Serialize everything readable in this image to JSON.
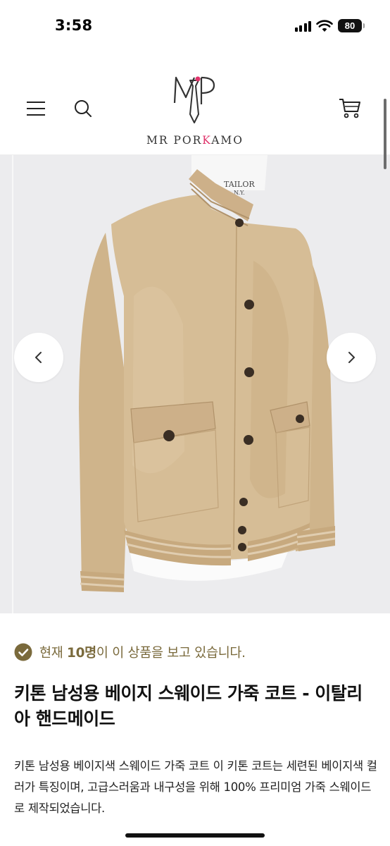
{
  "status_bar": {
    "time": "3:58",
    "battery": "80",
    "icons": [
      "cellular-signal-icon",
      "wifi-icon",
      "battery-icon"
    ]
  },
  "header": {
    "logo_mark": "MP",
    "logo_text_part1": "MR POR",
    "logo_text_accent": "K",
    "logo_text_part2": "AMO",
    "accent_color": "#e0336b",
    "icons": [
      "menu-icon",
      "search-icon",
      "cart-icon"
    ]
  },
  "gallery": {
    "mannequin_label": "TAILOR\nN.Y.",
    "prev_icon": "chevron-left-icon",
    "next_icon": "chevron-right-icon"
  },
  "product": {
    "viewers_prefix": "현재 ",
    "viewers_count": "10명",
    "viewers_suffix": "이 이 상품을 보고 있습니다.",
    "viewers_color": "#7a6a3c",
    "title": "키톤 남성용 베이지 스웨이드 가죽 코트 - 이탈리아 핸드메이드",
    "description": "키톤 남성용 베이지색 스웨이드 가죽 코트 이 키톤 코트는 세련된 베이지색 컬러가 특징이며, 고급스러움과 내구성을 위해 100% 프리미엄 가죽 스웨이드로 제작되었습니다."
  }
}
